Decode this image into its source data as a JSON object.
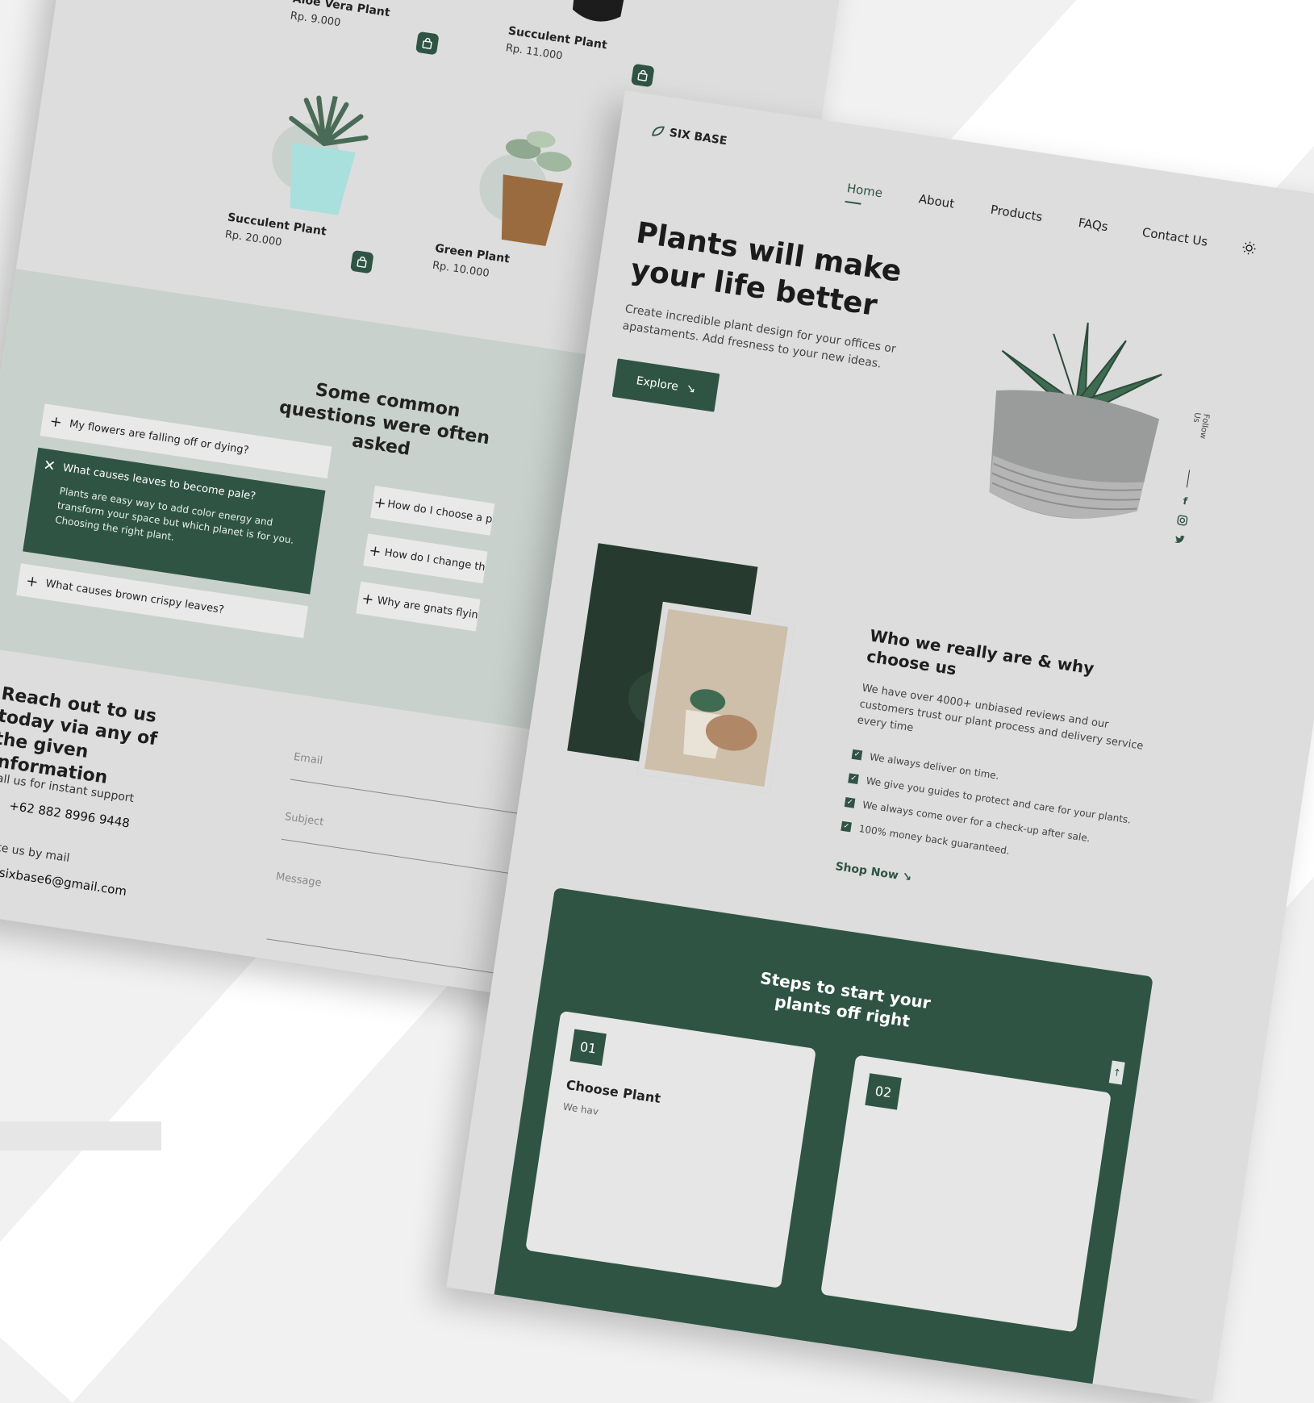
{
  "colors": {
    "accent": "#2f5444",
    "page_bg": "#dddddd",
    "faq_bg": "#c9d1cd",
    "backdrop": "#f1f1f1"
  },
  "back_page": {
    "products": [
      {
        "name": "Aloe Vera Plant",
        "price": "Rp. 9.000",
        "icon": "bag-icon"
      },
      {
        "name": "Succulent Plant",
        "price": "Rp. 11.000",
        "icon": "bag-icon"
      },
      {
        "name": "Succulent Plant",
        "price": "Rp. 20.000",
        "icon": "bag-icon"
      },
      {
        "name": "Green Plant",
        "price": "Rp. 10.000",
        "icon": "bag-icon"
      }
    ],
    "faq": {
      "title": "Some common questions were often asked",
      "items": [
        {
          "question": "My flowers are falling off or dying?",
          "icon": "plus-icon"
        },
        {
          "question": "What causes leaves to become pale?",
          "icon": "close-icon",
          "answer": "Plants are easy way to add color energy and transform your space but which planet is for you. Choosing the right plant."
        },
        {
          "question": "What causes brown crispy leaves?",
          "icon": "plus-icon"
        },
        {
          "question": "How do I choose a p",
          "icon": "plus-icon"
        },
        {
          "question": "How do I change th",
          "icon": "plus-icon"
        },
        {
          "question": "Why are gnats flyin",
          "icon": "plus-icon"
        }
      ]
    },
    "contact": {
      "title": "Reach out to us today via any of the given information",
      "call_label": "Call us for instant support",
      "phone": "+62 882 8996 9448",
      "mail_label": "Write us by mail",
      "email": "sixbase6@gmail.com",
      "form": {
        "email_label": "Email",
        "subject_label": "Subject",
        "message_label": "Message"
      }
    }
  },
  "front_page": {
    "brand": "SIX BASE",
    "nav": [
      "Home",
      "About",
      "Products",
      "FAQs",
      "Contact Us"
    ],
    "active_nav": "Home",
    "theme_icon": "sun-icon",
    "hero": {
      "title": "Plants will make your life better",
      "subtitle": "Create incredible plant design for your offices or apastaments. Add fresness to your new ideas.",
      "button": "Explore"
    },
    "social": {
      "label": "Follow Us",
      "icons": [
        "facebook-icon",
        "instagram-icon",
        "twitter-icon"
      ]
    },
    "why": {
      "title": "Who we really are & why choose us",
      "text": "We have over 4000+ unbiased reviews and our customers trust our plant process and delivery service every time",
      "checks": [
        "We always deliver on time.",
        "We give you guides to protect and care for your plants.",
        "We always come over for a check-up after sale.",
        "100% money back guaranteed."
      ],
      "link": "Shop Now"
    },
    "steps": {
      "title": "Steps to start your plants off right",
      "cards": [
        {
          "num": "01",
          "name": "Choose Plant",
          "desc": "We hav"
        },
        {
          "num": "02",
          "name": "",
          "desc": ""
        }
      ]
    }
  }
}
